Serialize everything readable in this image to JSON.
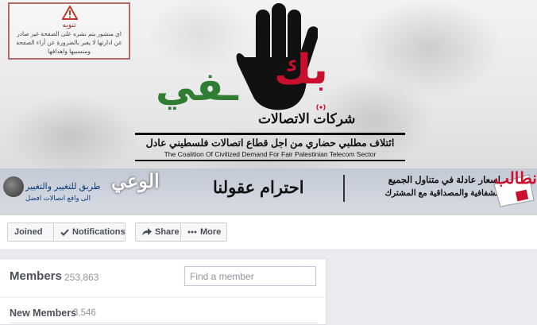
{
  "cover": {
    "warning": {
      "title": "تنويه",
      "text": "اي منشور يتم نشره على الصفحة غير صادر عن ادارتها لا يعبر بالضرورة عن أراء الصفحة ومنسبيها واهدافها"
    },
    "logo": {
      "red_word": "بك",
      "green_word": "ـفي",
      "subtitle": "شركات الاتصالات"
    },
    "coalition_arabic": "ائتلاف مطلبي حضاري من اجل قطاع اتصالات فلسطيني عادل",
    "coalition_english": "The Coalition Of Civilized Demand For Fair Palestinian Telecom Sector",
    "banner": {
      "awareness_title": "الوعي",
      "awareness_sub1": "طريق للتغيير والتغيير",
      "awareness_sub2": "الى واقع اتصالات افضل",
      "respect_slogan": "احترام عقولنا",
      "prices_line1": "اسعار عادلة في متناول الجميع",
      "prices_line2": "الشفافية والمصداقية مع المشترك",
      "demand_label": "نطالب"
    }
  },
  "actions": {
    "joined_label": "Joined",
    "notifications_label": "Notifications",
    "share_label": "Share",
    "more_label": "More"
  },
  "members": {
    "title": "Members",
    "count": "253,863",
    "search_placeholder": "Find a member",
    "new_members_title": "New Members",
    "new_members_count": "3,546"
  },
  "colors": {
    "brand_red": "#c8102e",
    "brand_green": "#2e7d32",
    "page_bg": "#e9ebee"
  }
}
